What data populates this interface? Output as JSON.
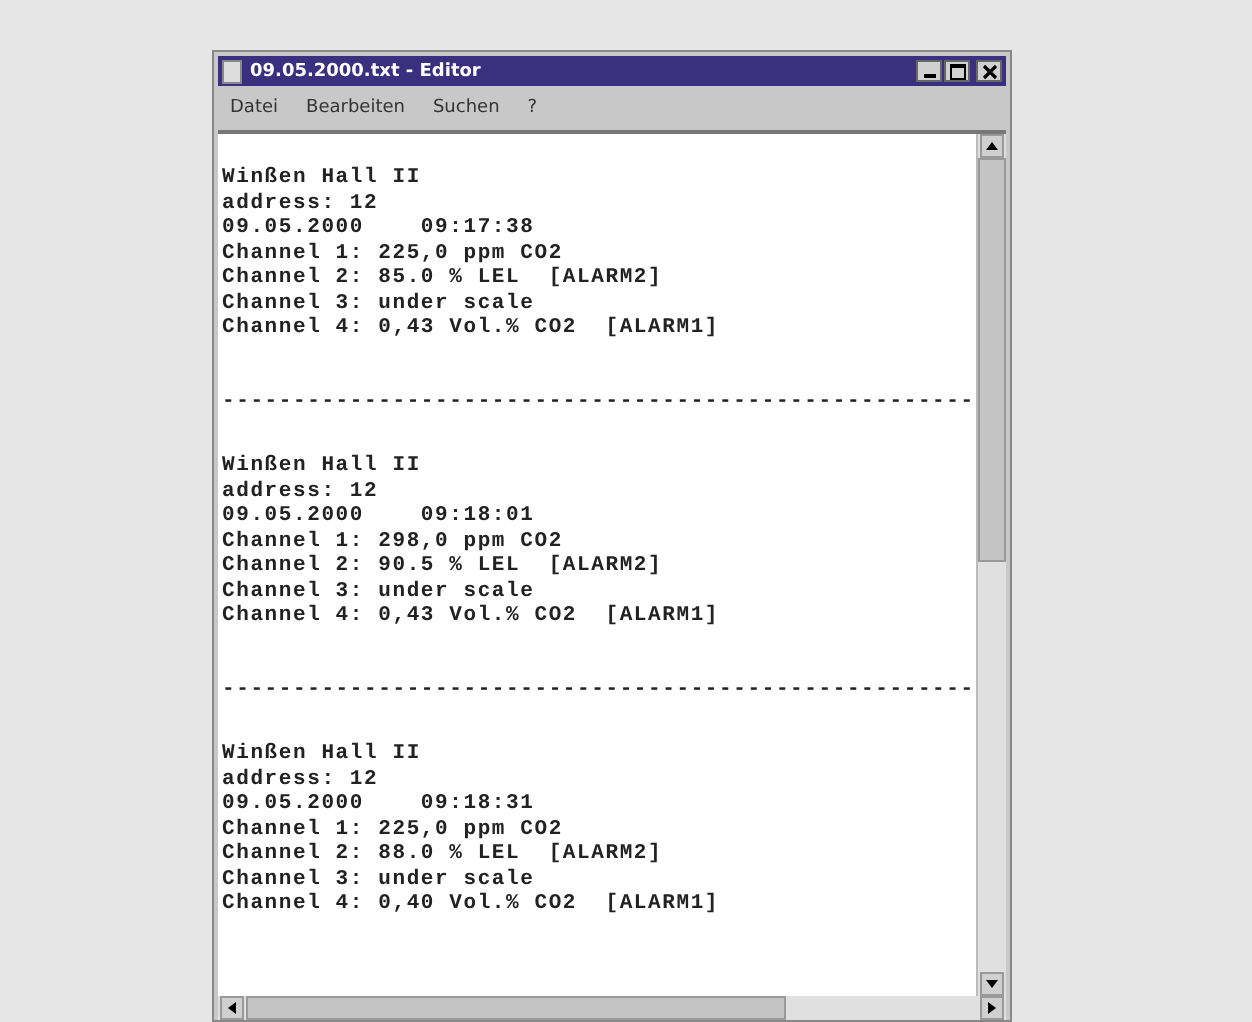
{
  "window": {
    "title": "09.05.2000.txt - Editor"
  },
  "menu": [
    "Datei",
    "Bearbeiten",
    "Suchen",
    "?"
  ],
  "document": [
    {
      "kind": "record",
      "lines": [
        "Winßen Hall II",
        "address: 12",
        "09.05.2000    09:17:38",
        "Channel 1: 225,0 ppm CO2",
        "Channel 2: 85.0 % LEL  [ALARM2]",
        "Channel 3: under scale",
        "Channel 4: 0,43 Vol.% CO2  [ALARM1]"
      ]
    },
    {
      "kind": "separator",
      "text": "-----------------------------------------------------"
    },
    {
      "kind": "record",
      "lines": [
        "Winßen Hall II",
        "address: 12",
        "09.05.2000    09:18:01",
        "Channel 1: 298,0 ppm CO2",
        "Channel 2: 90.5 % LEL  [ALARM2]",
        "Channel 3: under scale",
        "Channel 4: 0,43 Vol.% CO2  [ALARM1]"
      ]
    },
    {
      "kind": "separator",
      "text": "-----------------------------------------------------"
    },
    {
      "kind": "record",
      "lines": [
        "Winßen Hall II",
        "address: 12",
        "09.05.2000    09:18:31",
        "Channel 1: 225,0 ppm CO2",
        "Channel 2: 88.0 % LEL  [ALARM2]",
        "Channel 3: under scale",
        "Channel 4: 0,40 Vol.% CO2  [ALARM1]"
      ]
    }
  ]
}
